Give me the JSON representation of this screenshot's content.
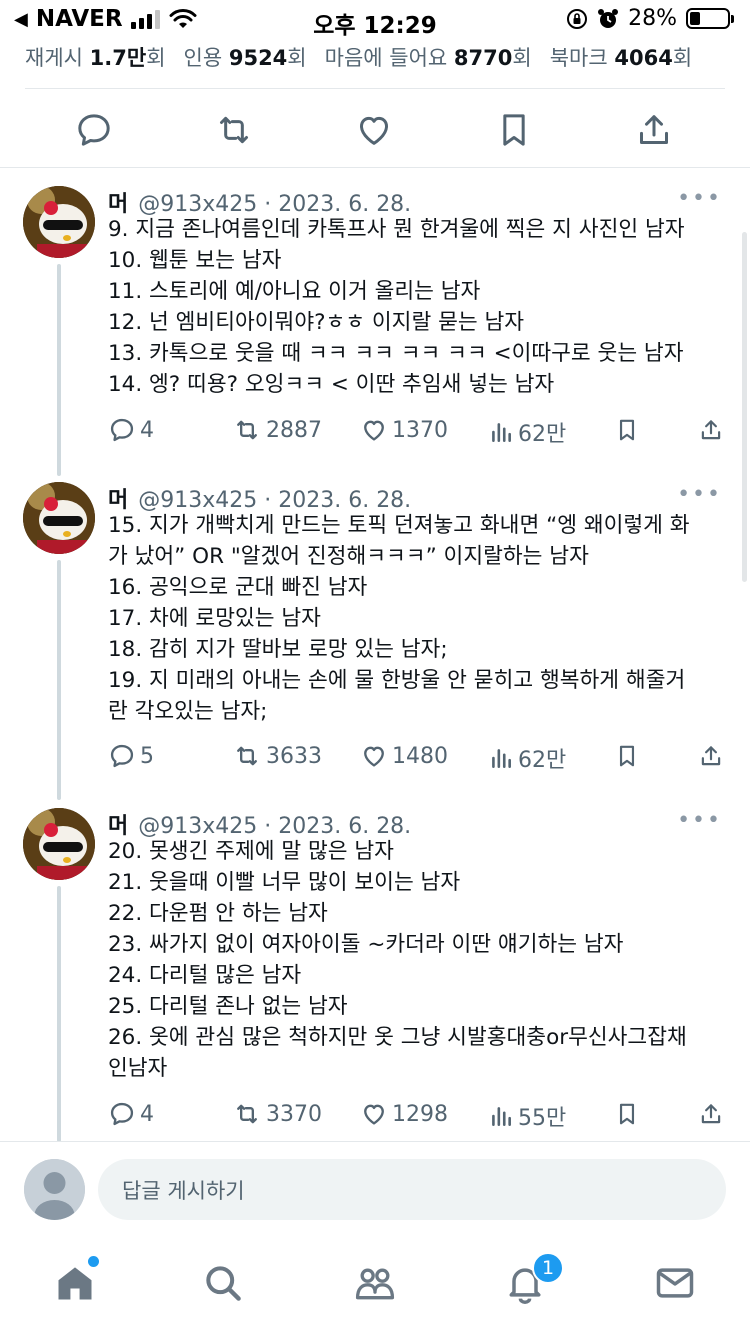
{
  "status_bar": {
    "back_app": "NAVER",
    "time": "오후 12:29",
    "battery_percent": "28%",
    "battery_level": 0.28
  },
  "stats": [
    {
      "label": "재게시",
      "value": "1.7만",
      "suffix": "회"
    },
    {
      "label": "인용",
      "value": "9524",
      "suffix": "회"
    },
    {
      "label": "마음에 들어요",
      "value": "8770",
      "suffix": "회"
    },
    {
      "label": "북마크",
      "value": "4064",
      "suffix": "회"
    }
  ],
  "tweets": [
    {
      "name": "머",
      "handle": "@913x425 · 2023. 6. 28.",
      "more": "•••",
      "lines": [
        "9. 지금 존나여름인데 카톡프사 뭔 한겨울에 찍은 지 사진인 남자",
        "10. 웹툰 보는 남자",
        "11. 스토리에 예/아니요 이거 올리는 남자",
        "12. 넌 엠비티아이뭐야?ㅎㅎ 이지랄 묻는 남자",
        "13. 카톡으로 웃을 때 ㅋㅋ ㅋㅋ ㅋㅋ ㅋㅋ <이따구로 웃는 남자",
        "14. 엥? 띠용? 오잉ㅋㅋ < 이딴 추임새 넣는 남자"
      ],
      "replies": "4",
      "reposts": "2887",
      "likes": "1370",
      "views": "62만"
    },
    {
      "name": "머",
      "handle": "@913x425 · 2023. 6. 28.",
      "more": "•••",
      "lines": [
        "15. 지가 개빡치게 만드는 토픽 던져놓고 화내면 “엥 왜이렇게 화",
        "가 났어” OR \"알겠어 진정해ㅋㅋㅋ” 이지랄하는 남자",
        "16. 공익으로 군대 빠진 남자",
        "17. 차에 로망있는 남자",
        "18. 감히 지가 딸바보 로망 있는 남자;",
        "19. 지 미래의 아내는 손에 물 한방울 안 묻히고 행복하게 해줄거",
        "란 각오있는 남자;"
      ],
      "replies": "5",
      "reposts": "3633",
      "likes": "1480",
      "views": "62만"
    },
    {
      "name": "머",
      "handle": "@913x425 · 2023. 6. 28.",
      "more": "•••",
      "lines": [
        "20. 못생긴 주제에 말 많은 남자",
        "21. 웃을때 이빨 너무 많이 보이는 남자",
        "22. 다운펌 안 하는 남자",
        "23. 싸가지 없이 여자아이돌 ~카더라 이딴 얘기하는 남자",
        "24. 다리털 많은 남자",
        "25. 다리털 존나 없는 남자",
        "26. 옷에 관심 많은 척하지만 옷 그냥 시발홍대충or무신사그잡채",
        "인남자"
      ],
      "replies": "4",
      "reposts": "3370",
      "likes": "1298",
      "views": "55만"
    }
  ],
  "reply": {
    "placeholder": "답글 게시하기"
  },
  "bottom_nav": {
    "notifications_count": "1"
  },
  "colors": {
    "accent": "#1d9bf0",
    "secondary_text": "#536471",
    "primary_text": "#0f1419"
  }
}
